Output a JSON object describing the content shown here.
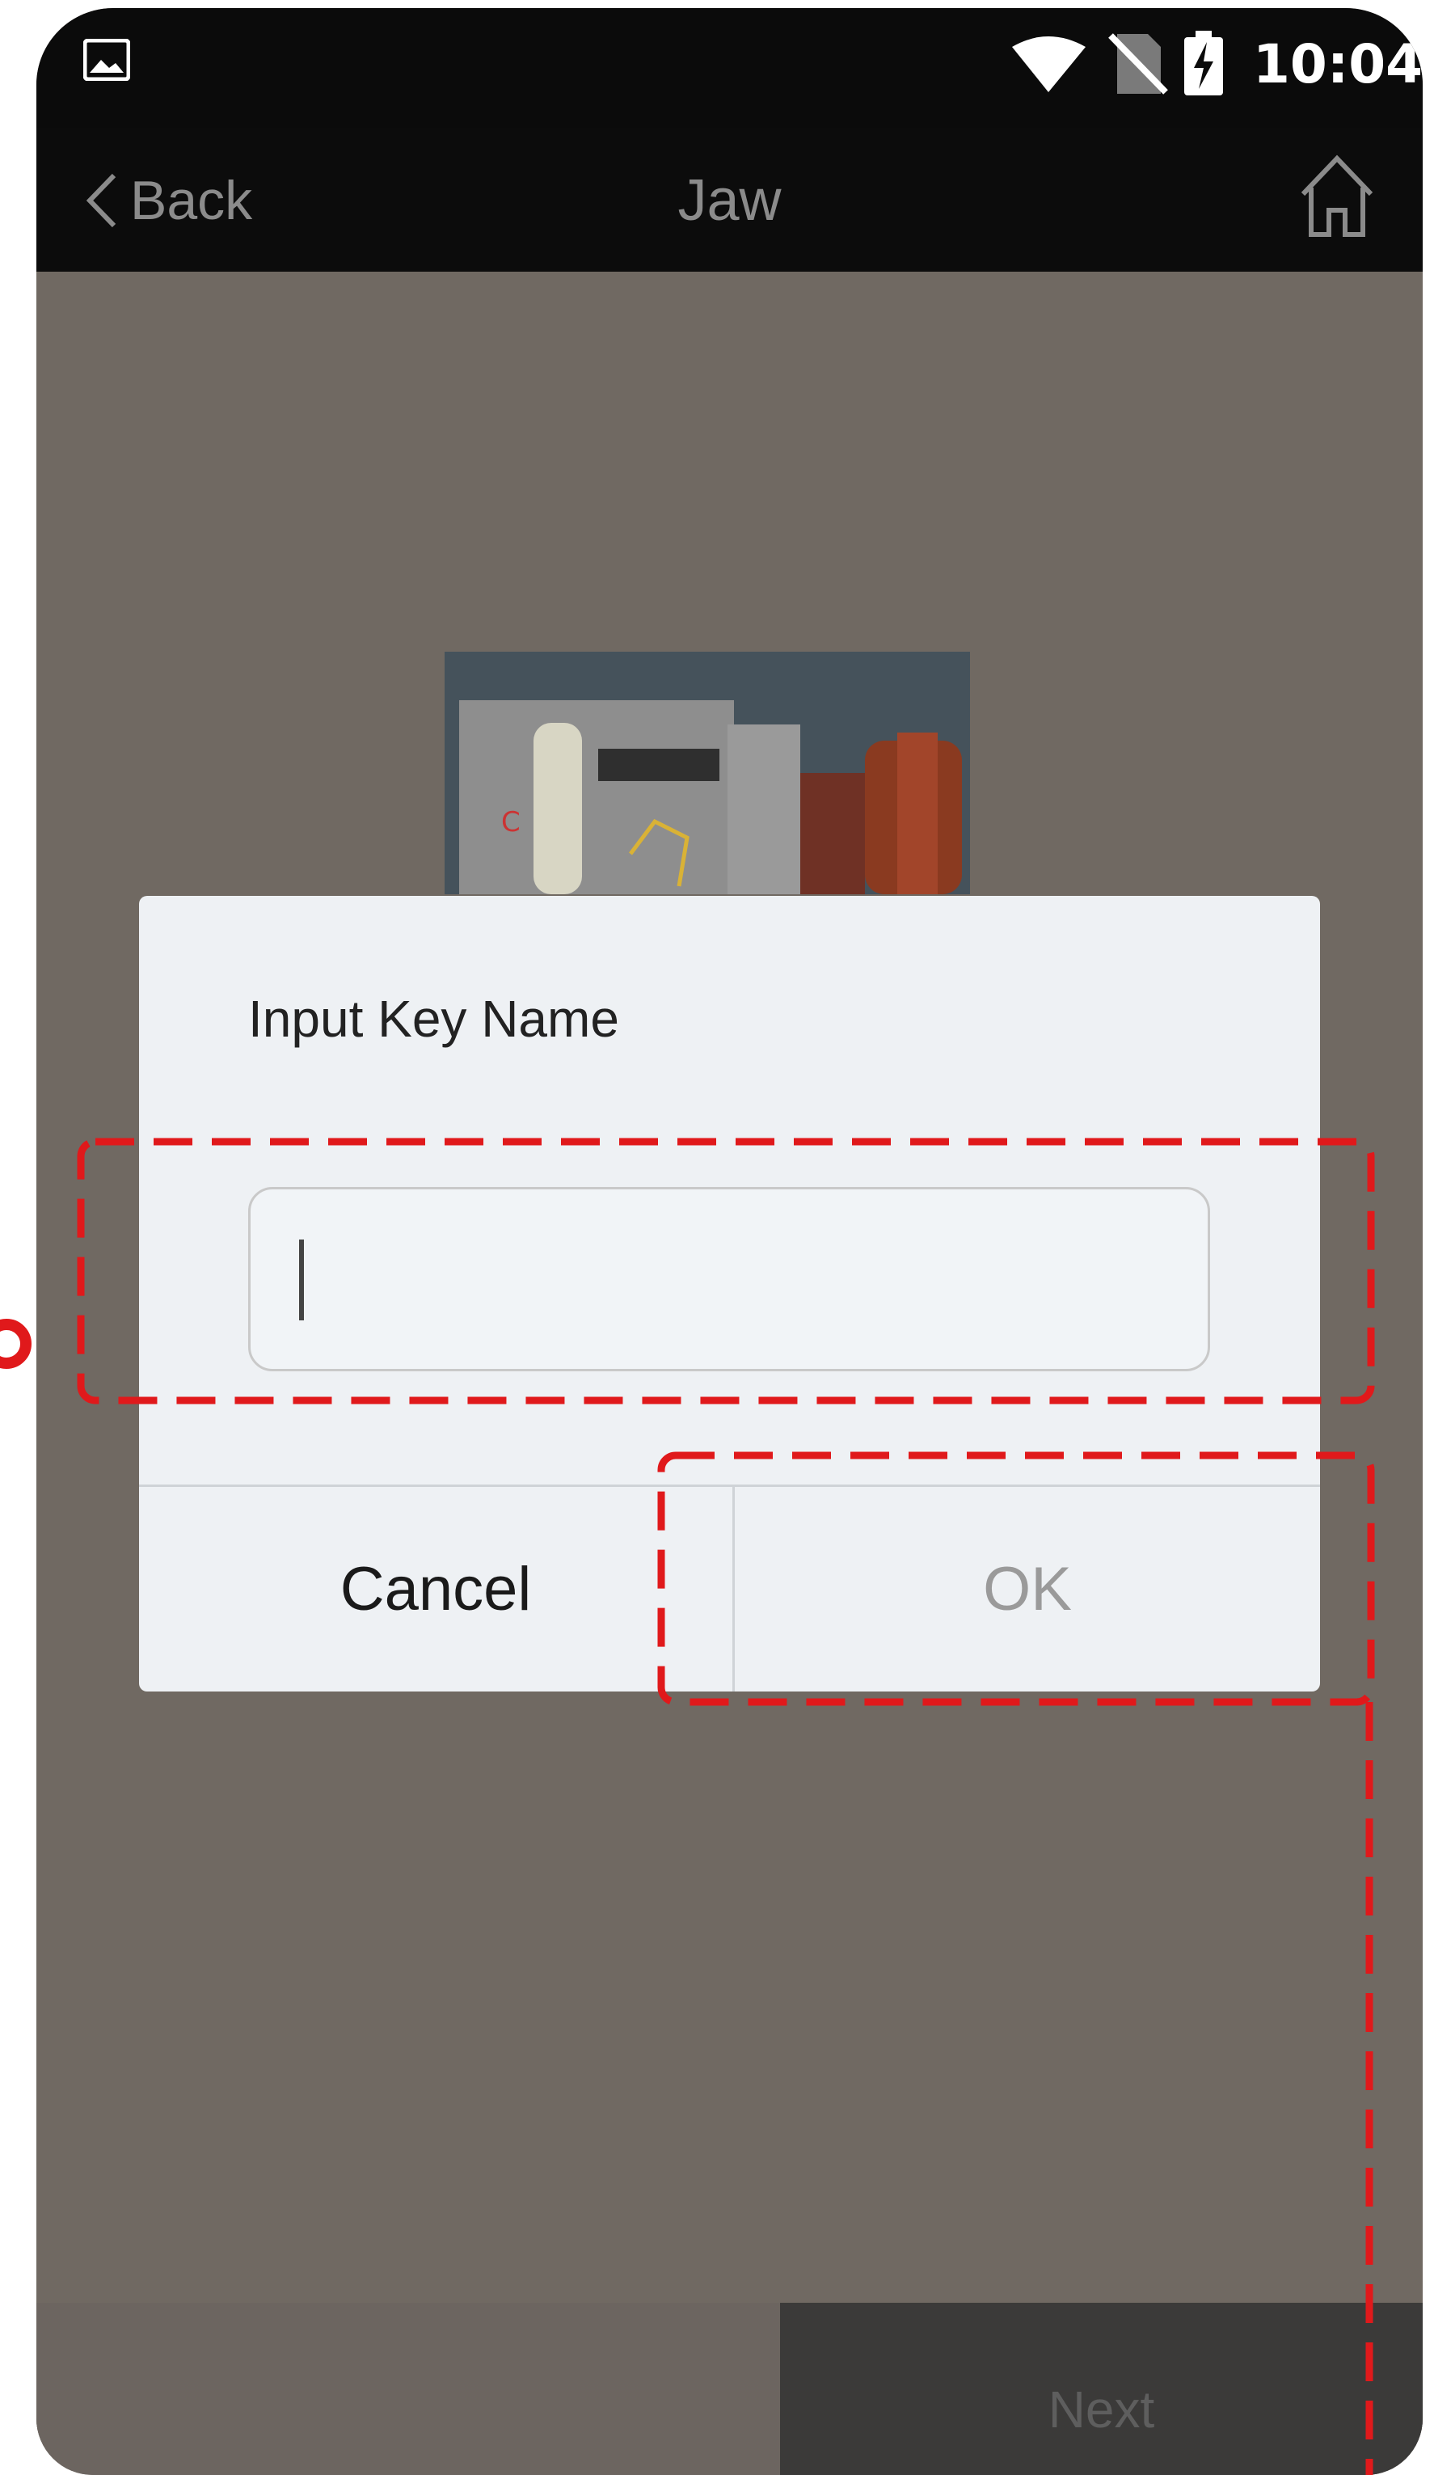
{
  "status_bar": {
    "time": "10:04",
    "icons": [
      "image-icon",
      "wifi-icon",
      "no-sim-icon",
      "battery-charging-icon"
    ]
  },
  "nav": {
    "back_label": "Back",
    "title": "Jaw",
    "home_icon": "home-icon"
  },
  "dialog": {
    "title": "Input Key Name",
    "input_value": "",
    "cancel_label": "Cancel",
    "ok_label": "OK"
  },
  "footer": {
    "next_label": "Next"
  },
  "colors": {
    "annotation": "#e0191b",
    "dialog_bg": "#eef1f4",
    "overlay_bg": "#706962",
    "bar_bg": "#0b0b0b"
  }
}
